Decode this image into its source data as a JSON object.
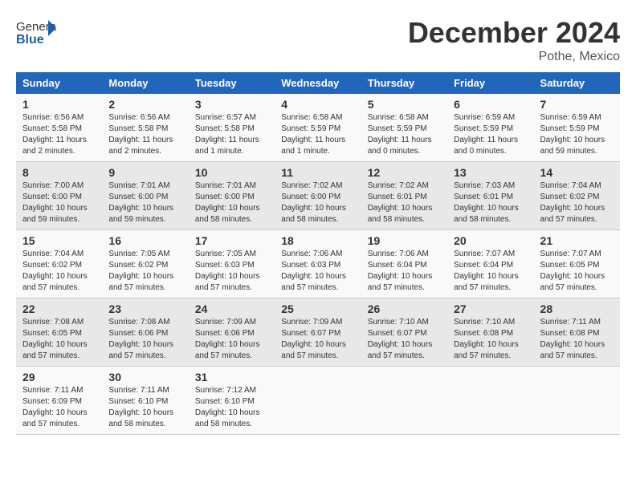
{
  "header": {
    "logo_general": "General",
    "logo_blue": "Blue",
    "month_title": "December 2024",
    "location": "Pothe, Mexico"
  },
  "days_of_week": [
    "Sunday",
    "Monday",
    "Tuesday",
    "Wednesday",
    "Thursday",
    "Friday",
    "Saturday"
  ],
  "weeks": [
    [
      {
        "day": 1,
        "info": "Sunrise: 6:56 AM\nSunset: 5:58 PM\nDaylight: 11 hours and 2 minutes."
      },
      {
        "day": 2,
        "info": "Sunrise: 6:56 AM\nSunset: 5:58 PM\nDaylight: 11 hours and 2 minutes."
      },
      {
        "day": 3,
        "info": "Sunrise: 6:57 AM\nSunset: 5:58 PM\nDaylight: 11 hours and 1 minute."
      },
      {
        "day": 4,
        "info": "Sunrise: 6:58 AM\nSunset: 5:59 PM\nDaylight: 11 hours and 1 minute."
      },
      {
        "day": 5,
        "info": "Sunrise: 6:58 AM\nSunset: 5:59 PM\nDaylight: 11 hours and 0 minutes."
      },
      {
        "day": 6,
        "info": "Sunrise: 6:59 AM\nSunset: 5:59 PM\nDaylight: 11 hours and 0 minutes."
      },
      {
        "day": 7,
        "info": "Sunrise: 6:59 AM\nSunset: 5:59 PM\nDaylight: 10 hours and 59 minutes."
      }
    ],
    [
      {
        "day": 8,
        "info": "Sunrise: 7:00 AM\nSunset: 6:00 PM\nDaylight: 10 hours and 59 minutes."
      },
      {
        "day": 9,
        "info": "Sunrise: 7:01 AM\nSunset: 6:00 PM\nDaylight: 10 hours and 59 minutes."
      },
      {
        "day": 10,
        "info": "Sunrise: 7:01 AM\nSunset: 6:00 PM\nDaylight: 10 hours and 58 minutes."
      },
      {
        "day": 11,
        "info": "Sunrise: 7:02 AM\nSunset: 6:00 PM\nDaylight: 10 hours and 58 minutes."
      },
      {
        "day": 12,
        "info": "Sunrise: 7:02 AM\nSunset: 6:01 PM\nDaylight: 10 hours and 58 minutes."
      },
      {
        "day": 13,
        "info": "Sunrise: 7:03 AM\nSunset: 6:01 PM\nDaylight: 10 hours and 58 minutes."
      },
      {
        "day": 14,
        "info": "Sunrise: 7:04 AM\nSunset: 6:02 PM\nDaylight: 10 hours and 57 minutes."
      }
    ],
    [
      {
        "day": 15,
        "info": "Sunrise: 7:04 AM\nSunset: 6:02 PM\nDaylight: 10 hours and 57 minutes."
      },
      {
        "day": 16,
        "info": "Sunrise: 7:05 AM\nSunset: 6:02 PM\nDaylight: 10 hours and 57 minutes."
      },
      {
        "day": 17,
        "info": "Sunrise: 7:05 AM\nSunset: 6:03 PM\nDaylight: 10 hours and 57 minutes."
      },
      {
        "day": 18,
        "info": "Sunrise: 7:06 AM\nSunset: 6:03 PM\nDaylight: 10 hours and 57 minutes."
      },
      {
        "day": 19,
        "info": "Sunrise: 7:06 AM\nSunset: 6:04 PM\nDaylight: 10 hours and 57 minutes."
      },
      {
        "day": 20,
        "info": "Sunrise: 7:07 AM\nSunset: 6:04 PM\nDaylight: 10 hours and 57 minutes."
      },
      {
        "day": 21,
        "info": "Sunrise: 7:07 AM\nSunset: 6:05 PM\nDaylight: 10 hours and 57 minutes."
      }
    ],
    [
      {
        "day": 22,
        "info": "Sunrise: 7:08 AM\nSunset: 6:05 PM\nDaylight: 10 hours and 57 minutes."
      },
      {
        "day": 23,
        "info": "Sunrise: 7:08 AM\nSunset: 6:06 PM\nDaylight: 10 hours and 57 minutes."
      },
      {
        "day": 24,
        "info": "Sunrise: 7:09 AM\nSunset: 6:06 PM\nDaylight: 10 hours and 57 minutes."
      },
      {
        "day": 25,
        "info": "Sunrise: 7:09 AM\nSunset: 6:07 PM\nDaylight: 10 hours and 57 minutes."
      },
      {
        "day": 26,
        "info": "Sunrise: 7:10 AM\nSunset: 6:07 PM\nDaylight: 10 hours and 57 minutes."
      },
      {
        "day": 27,
        "info": "Sunrise: 7:10 AM\nSunset: 6:08 PM\nDaylight: 10 hours and 57 minutes."
      },
      {
        "day": 28,
        "info": "Sunrise: 7:11 AM\nSunset: 6:08 PM\nDaylight: 10 hours and 57 minutes."
      }
    ],
    [
      {
        "day": 29,
        "info": "Sunrise: 7:11 AM\nSunset: 6:09 PM\nDaylight: 10 hours and 57 minutes."
      },
      {
        "day": 30,
        "info": "Sunrise: 7:11 AM\nSunset: 6:10 PM\nDaylight: 10 hours and 58 minutes."
      },
      {
        "day": 31,
        "info": "Sunrise: 7:12 AM\nSunset: 6:10 PM\nDaylight: 10 hours and 58 minutes."
      },
      null,
      null,
      null,
      null
    ]
  ]
}
